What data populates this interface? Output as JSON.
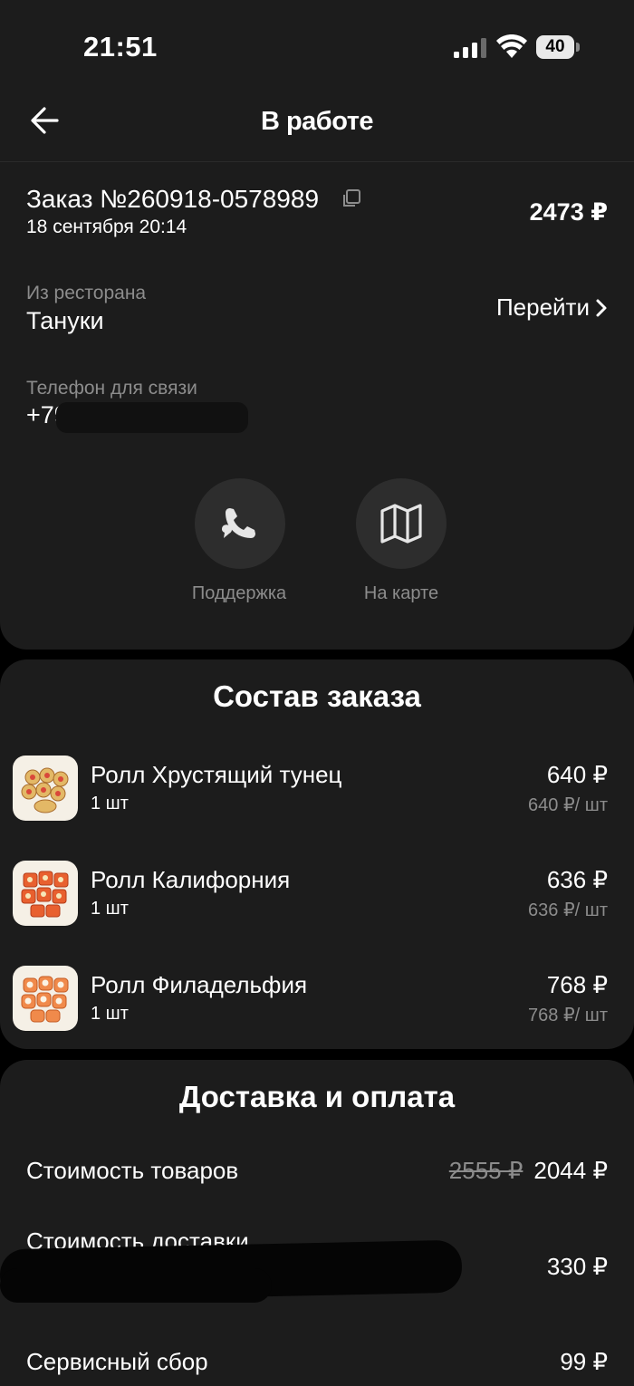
{
  "status_bar": {
    "time": "21:51",
    "battery": "40"
  },
  "header": {
    "title": "В работе"
  },
  "order": {
    "number": "Заказ №260918-0578989",
    "date": "18 сентября 20:14",
    "total": "2473 ₽",
    "restaurant_label": "Из ресторана",
    "restaurant_name": "Тануки",
    "goto_label": "Перейти",
    "phone_label": "Телефон для связи",
    "phone_visible": "+79"
  },
  "actions": [
    {
      "label": "Поддержка",
      "icon": "phone-chat-icon"
    },
    {
      "label": "На карте",
      "icon": "map-icon"
    }
  ],
  "composition": {
    "title": "Состав заказа",
    "items": [
      {
        "name": "Ролл Хрустящий тунец",
        "qty": "1 шт",
        "price": "640 ₽",
        "unit_price": "640 ₽/ шт"
      },
      {
        "name": "Ролл Калифорния",
        "qty": "1 шт",
        "price": "636 ₽",
        "unit_price": "636 ₽/ шт"
      },
      {
        "name": "Ролл Филадельфия",
        "qty": "1 шт",
        "price": "768 ₽",
        "unit_price": "768 ₽/ шт"
      }
    ]
  },
  "delivery": {
    "title": "Доставка и оплата",
    "rows": [
      {
        "label": "Стоимость товаров",
        "old_value": "2555 ₽",
        "value": "2044 ₽"
      },
      {
        "label": "Стоимость доставки",
        "value": "330 ₽"
      },
      {
        "label": "Сервисный сбор",
        "value": "99 ₽"
      }
    ]
  },
  "colors": {
    "background": "#000000",
    "card": "#1c1c1c",
    "secondary_text": "#8c8c8c",
    "action_circle": "#2d2d2d"
  }
}
